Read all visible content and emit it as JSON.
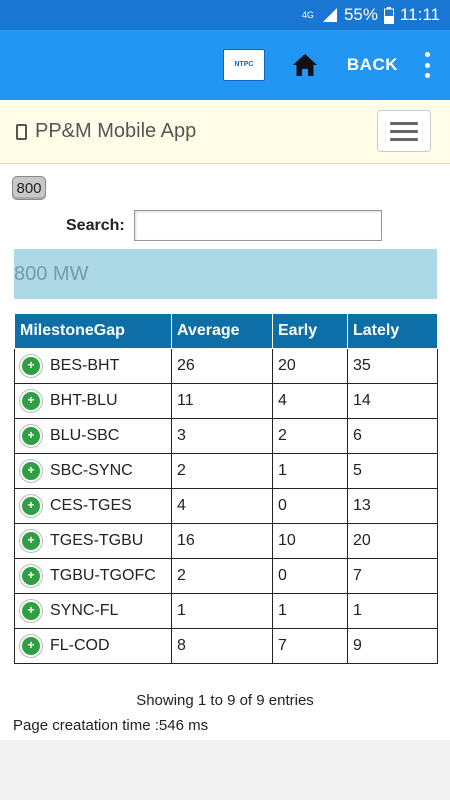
{
  "status_bar": {
    "network": "4G",
    "battery": "55%",
    "time": "11:11"
  },
  "app_bar": {
    "logo_text": "NTPC",
    "back_label": "BACK"
  },
  "navbar": {
    "brand": "PP&M Mobile App"
  },
  "filter": {
    "chip": "800",
    "search_label": "Search:",
    "search_value": "",
    "section_title": "800 MW"
  },
  "table": {
    "headers": [
      "MilestoneGap",
      "Average",
      "Early",
      "Lately"
    ],
    "rows": [
      {
        "gap": "BES-BHT",
        "average": "26",
        "early": "20",
        "lately": "35"
      },
      {
        "gap": "BHT-BLU",
        "average": "11",
        "early": "4",
        "lately": "14"
      },
      {
        "gap": "BLU-SBC",
        "average": "3",
        "early": "2",
        "lately": "6"
      },
      {
        "gap": "SBC-SYNC",
        "average": "2",
        "early": "1",
        "lately": "5"
      },
      {
        "gap": "CES-TGES",
        "average": "4",
        "early": "0",
        "lately": "13"
      },
      {
        "gap": "TGES-TGBU",
        "average": "16",
        "early": "10",
        "lately": "20"
      },
      {
        "gap": "TGBU-TGOFC",
        "average": "2",
        "early": "0",
        "lately": "7"
      },
      {
        "gap": "SYNC-FL",
        "average": "1",
        "early": "1",
        "lately": "1"
      },
      {
        "gap": "FL-COD",
        "average": "8",
        "early": "7",
        "lately": "9"
      }
    ]
  },
  "footer": {
    "entries_info": "Showing 1 to 9 of 9 entries",
    "page_time": "Page creatation time :546 ms"
  },
  "icons": {
    "expand": "plus-circle-icon",
    "home": "home-icon",
    "menu": "hamburger-icon",
    "more": "more-vert-icon"
  },
  "colors": {
    "status_bar": "#1976d2",
    "app_bar": "#2196f3",
    "navbar": "#fffde7",
    "banner": "#add8e6",
    "table_header": "#0d6ea8",
    "expand_icon": "#2ea043"
  }
}
